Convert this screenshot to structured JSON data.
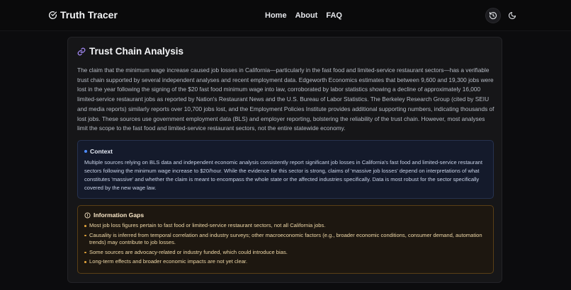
{
  "header": {
    "brand": "Truth Tracer",
    "nav": [
      "Home",
      "About",
      "FAQ"
    ]
  },
  "card": {
    "title": "Trust Chain Analysis",
    "summary": "The claim that the minimum wage increase caused job losses in California—particularly in the fast food and limited-service restaurant sectors—has a verifiable trust chain supported by several independent analyses and recent employment data. Edgeworth Economics estimates that between 9,600 and 19,300 jobs were lost in the year following the signing of the $20 fast food minimum wage into law, corroborated by labor statistics showing a decline of approximately 16,000 limited-service restaurant jobs as reported by Nation's Restaurant News and the U.S. Bureau of Labor Statistics. The Berkeley Research Group (cited by SEIU and media reports) similarly reports over 10,700 jobs lost, and the Employment Policies Institute provides additional supporting numbers, indicating thousands of lost jobs. These sources use government employment data (BLS) and employer reporting, bolstering the reliability of the trust chain. However, most analyses limit the scope to the fast food and limited-service restaurant sectors, not the entire statewide economy."
  },
  "context": {
    "heading": "Context",
    "text": "Multiple sources relying on BLS data and independent economic analysis consistently report significant job losses in California's fast food and limited-service restaurant sectors following the minimum wage increase to $20/hour. While the evidence for this sector is strong, claims of 'massive job losses' depend on interpretations of what constitutes 'massive' and whether the claim is meant to encompass the whole state or the affected industries specifically. Data is most robust for the sector specifically covered by the new wage law."
  },
  "gaps": {
    "heading": "Information Gaps",
    "items": [
      "Most job loss figures pertain to fast food or limited-service restaurant sectors, not all California jobs.",
      "Causality is inferred from temporal correlation and industry surveys; other macroeconomic factors (e.g., broader economic conditions, consumer demand, automation trends) may contribute to job losses.",
      "Some sources are advocacy-related or industry funded, which could introduce bias.",
      "Long-term effects and broader economic impacts are not yet clear."
    ]
  },
  "colors": {
    "background": "#0c0c0e",
    "card": "#161618",
    "context_accent": "#4f8cff",
    "gaps_accent": "#e0a23a",
    "link_icon": "#a78bfa"
  }
}
